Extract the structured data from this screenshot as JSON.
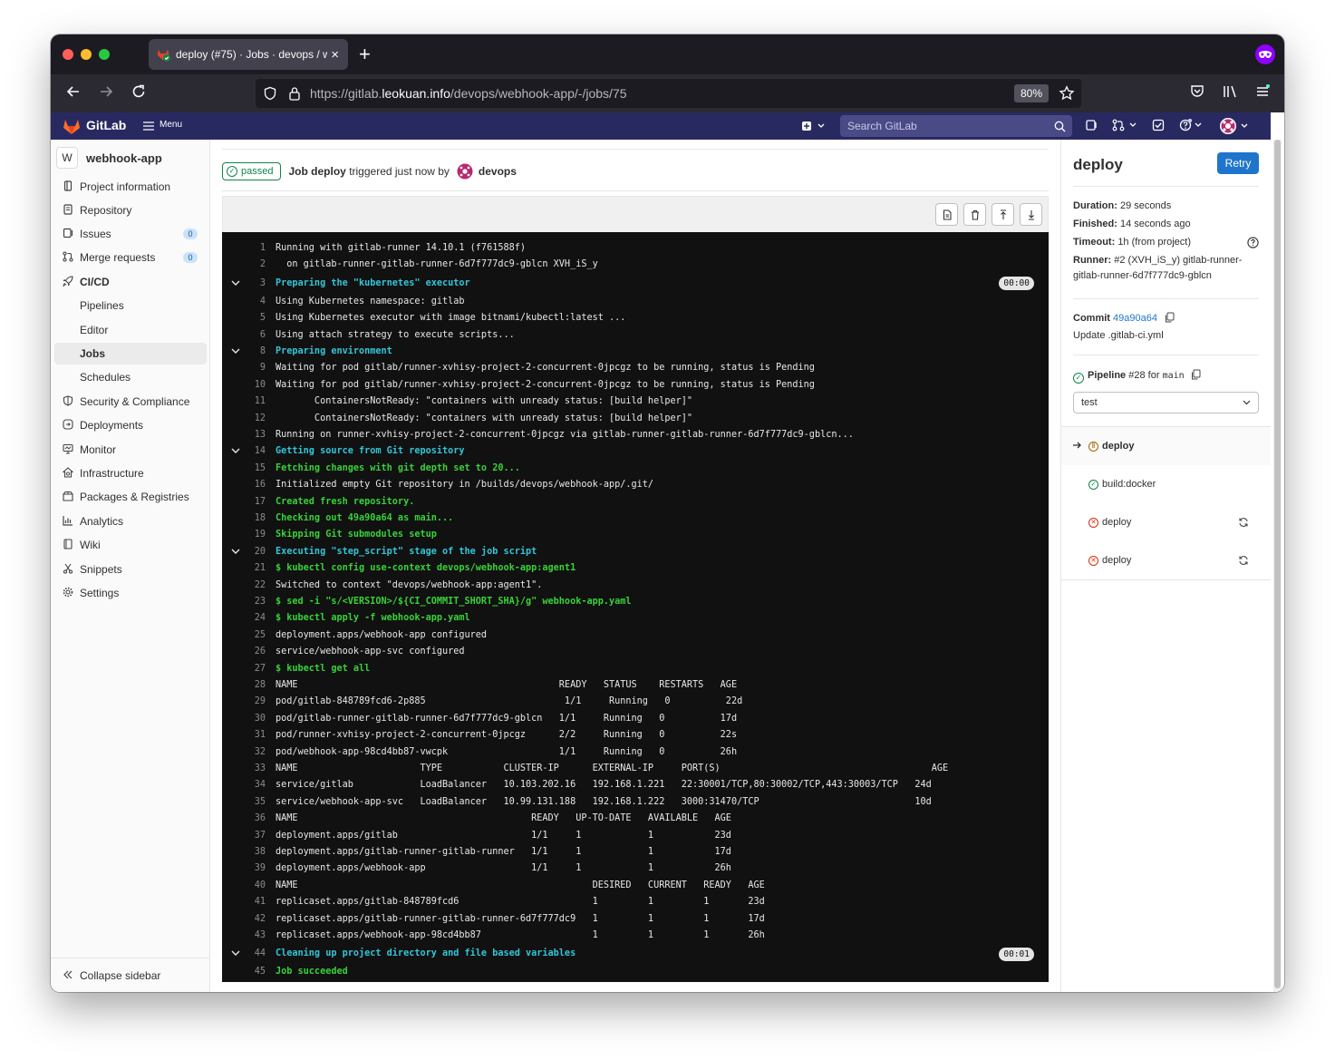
{
  "browser": {
    "tab_title": "deploy (#75) · Jobs · devops / w",
    "url_prefix": "https://gitlab.",
    "url_host": "leokuan.info",
    "url_path": "/devops/webhook-app/-/jobs/75",
    "zoom": "80%"
  },
  "gitlab_header": {
    "brand": "GitLab",
    "menu_label": "Menu",
    "search_placeholder": "Search GitLab"
  },
  "sidebar": {
    "project_avatar": "W",
    "project_name": "webhook-app",
    "items": [
      {
        "label": "Project information",
        "icon": "info-icon"
      },
      {
        "label": "Repository",
        "icon": "doc-icon"
      },
      {
        "label": "Issues",
        "icon": "issues-icon",
        "badge": "0"
      },
      {
        "label": "Merge requests",
        "icon": "merge-request-icon",
        "badge": "0"
      },
      {
        "label": "CI/CD",
        "icon": "rocket-icon"
      },
      {
        "label": "Pipelines"
      },
      {
        "label": "Editor"
      },
      {
        "label": "Jobs"
      },
      {
        "label": "Schedules"
      },
      {
        "label": "Security & Compliance",
        "icon": "shield-icon"
      },
      {
        "label": "Deployments",
        "icon": "deployments-icon"
      },
      {
        "label": "Monitor",
        "icon": "monitor-icon"
      },
      {
        "label": "Infrastructure",
        "icon": "infrastructure-icon"
      },
      {
        "label": "Packages & Registries",
        "icon": "package-icon"
      },
      {
        "label": "Analytics",
        "icon": "chart-icon"
      },
      {
        "label": "Wiki",
        "icon": "book-icon"
      },
      {
        "label": "Snippets",
        "icon": "snippet-icon"
      },
      {
        "label": "Settings",
        "icon": "gear-icon"
      }
    ],
    "collapse_label": "Collapse sidebar"
  },
  "job_header": {
    "status": "passed",
    "job_prefix": "Job",
    "job_name": "deploy",
    "triggered_text": "triggered just now by",
    "user": "devops"
  },
  "log": {
    "lines": [
      {
        "n": "1",
        "t": "Running with gitlab-runner 14.10.1 (f761588f)",
        "k": "plain"
      },
      {
        "n": "2",
        "t": "  on gitlab-runner-gitlab-runner-6d7f777dc9-gblcn XVH_iS_y",
        "k": "plain"
      },
      {
        "n": "3",
        "t": "Preparing the \"kubernetes\" executor",
        "k": "sec",
        "dur": "00:00"
      },
      {
        "n": "4",
        "t": "Using Kubernetes namespace: gitlab",
        "k": "plain"
      },
      {
        "n": "5",
        "t": "Using Kubernetes executor with image bitnami/kubectl:latest ...",
        "k": "plain"
      },
      {
        "n": "6",
        "t": "Using attach strategy to execute scripts...",
        "k": "plain"
      },
      {
        "n": "8",
        "t": "Preparing environment",
        "k": "sec"
      },
      {
        "n": "9",
        "t": "Waiting for pod gitlab/runner-xvhisy-project-2-concurrent-0jpcgz to be running, status is Pending",
        "k": "plain"
      },
      {
        "n": "10",
        "t": "Waiting for pod gitlab/runner-xvhisy-project-2-concurrent-0jpcgz to be running, status is Pending",
        "k": "plain"
      },
      {
        "n": "11",
        "t": "       ContainersNotReady: \"containers with unready status: [build helper]\"",
        "k": "plain"
      },
      {
        "n": "12",
        "t": "       ContainersNotReady: \"containers with unready status: [build helper]\"",
        "k": "plain"
      },
      {
        "n": "13",
        "t": "Running on runner-xvhisy-project-2-concurrent-0jpcgz via gitlab-runner-gitlab-runner-6d7f777dc9-gblcn...",
        "k": "plain"
      },
      {
        "n": "14",
        "t": "Getting source from Git repository",
        "k": "sec"
      },
      {
        "n": "15",
        "t": "Fetching changes with git depth set to 20...",
        "k": "cmd"
      },
      {
        "n": "16",
        "t": "Initialized empty Git repository in /builds/devops/webhook-app/.git/",
        "k": "plain"
      },
      {
        "n": "17",
        "t": "Created fresh repository.",
        "k": "cmd"
      },
      {
        "n": "18",
        "t": "Checking out 49a90a64 as main...",
        "k": "cmd"
      },
      {
        "n": "19",
        "t": "Skipping Git submodules setup",
        "k": "cmd"
      },
      {
        "n": "20",
        "t": "Executing \"step_script\" stage of the job script",
        "k": "sec"
      },
      {
        "n": "21",
        "t": "$ kubectl config use-context devops/webhook-app:agent1",
        "k": "cmd"
      },
      {
        "n": "22",
        "t": "Switched to context \"devops/webhook-app:agent1\".",
        "k": "plain"
      },
      {
        "n": "23",
        "t": "$ sed -i \"s/<VERSION>/${CI_COMMIT_SHORT_SHA}/g\" webhook-app.yaml",
        "k": "cmd"
      },
      {
        "n": "24",
        "t": "$ kubectl apply -f webhook-app.yaml",
        "k": "cmd"
      },
      {
        "n": "25",
        "t": "deployment.apps/webhook-app configured",
        "k": "plain"
      },
      {
        "n": "26",
        "t": "service/webhook-app-svc configured",
        "k": "plain"
      },
      {
        "n": "27",
        "t": "$ kubectl get all",
        "k": "cmd"
      },
      {
        "n": "28",
        "t": "NAME                                               READY   STATUS    RESTARTS   AGE",
        "k": "plain"
      },
      {
        "n": "29",
        "t": "pod/gitlab-848789fcd6-2p885                         1/1     Running   0          22d",
        "k": "plain"
      },
      {
        "n": "30",
        "t": "pod/gitlab-runner-gitlab-runner-6d7f777dc9-gblcn   1/1     Running   0          17d",
        "k": "plain"
      },
      {
        "n": "31",
        "t": "pod/runner-xvhisy-project-2-concurrent-0jpcgz      2/2     Running   0          22s",
        "k": "plain"
      },
      {
        "n": "32",
        "t": "pod/webhook-app-98cd4bb87-vwcpk                    1/1     Running   0          26h",
        "k": "plain"
      },
      {
        "n": "33",
        "t": "NAME                      TYPE           CLUSTER-IP      EXTERNAL-IP     PORT(S)                                      AGE",
        "k": "plain"
      },
      {
        "n": "34",
        "t": "service/gitlab            LoadBalancer   10.103.202.16   192.168.1.221   22:30001/TCP,80:30002/TCP,443:30003/TCP   24d",
        "k": "plain"
      },
      {
        "n": "35",
        "t": "service/webhook-app-svc   LoadBalancer   10.99.131.188   192.168.1.222   3000:31470/TCP                            10d",
        "k": "plain"
      },
      {
        "n": "36",
        "t": "NAME                                          READY   UP-TO-DATE   AVAILABLE   AGE",
        "k": "plain"
      },
      {
        "n": "37",
        "t": "deployment.apps/gitlab                        1/1     1            1           23d",
        "k": "plain"
      },
      {
        "n": "38",
        "t": "deployment.apps/gitlab-runner-gitlab-runner   1/1     1            1           17d",
        "k": "plain"
      },
      {
        "n": "39",
        "t": "deployment.apps/webhook-app                   1/1     1            1           26h",
        "k": "plain"
      },
      {
        "n": "40",
        "t": "NAME                                                     DESIRED   CURRENT   READY   AGE",
        "k": "plain"
      },
      {
        "n": "41",
        "t": "replicaset.apps/gitlab-848789fcd6                        1         1         1       23d",
        "k": "plain"
      },
      {
        "n": "42",
        "t": "replicaset.apps/gitlab-runner-gitlab-runner-6d7f777dc9   1         1         1       17d",
        "k": "plain"
      },
      {
        "n": "43",
        "t": "replicaset.apps/webhook-app-98cd4bb87                    1         1         1       26h",
        "k": "plain"
      },
      {
        "n": "44",
        "t": "Cleaning up project directory and file based variables",
        "k": "sec",
        "dur": "00:01"
      },
      {
        "n": "45",
        "t": "Job succeeded",
        "k": "cmd"
      }
    ]
  },
  "right_panel": {
    "title": "deploy",
    "retry_label": "Retry",
    "duration_label": "Duration:",
    "duration_value": "29 seconds",
    "finished_label": "Finished:",
    "finished_value": "14 seconds ago",
    "timeout_label": "Timeout:",
    "timeout_value": "1h (from project)",
    "runner_label": "Runner:",
    "runner_value_1": "#2 (XVH_iS_y) gitlab-runner-",
    "runner_value_2": "gitlab-runner-6d7f777dc9-gblcn",
    "commit_label": "Commit",
    "commit_sha": "49a90a64",
    "commit_message": "Update .gitlab-ci.yml",
    "pipeline_label": "Pipeline",
    "pipeline_id": "#28",
    "pipeline_for": "for",
    "pipeline_branch": "main",
    "stage_select": "test",
    "jobs": [
      {
        "name": "deploy",
        "status": "running",
        "current": true
      },
      {
        "name": "build:docker",
        "status": "success"
      },
      {
        "name": "deploy",
        "status": "failed"
      },
      {
        "name": "deploy",
        "status": "failed"
      }
    ]
  }
}
